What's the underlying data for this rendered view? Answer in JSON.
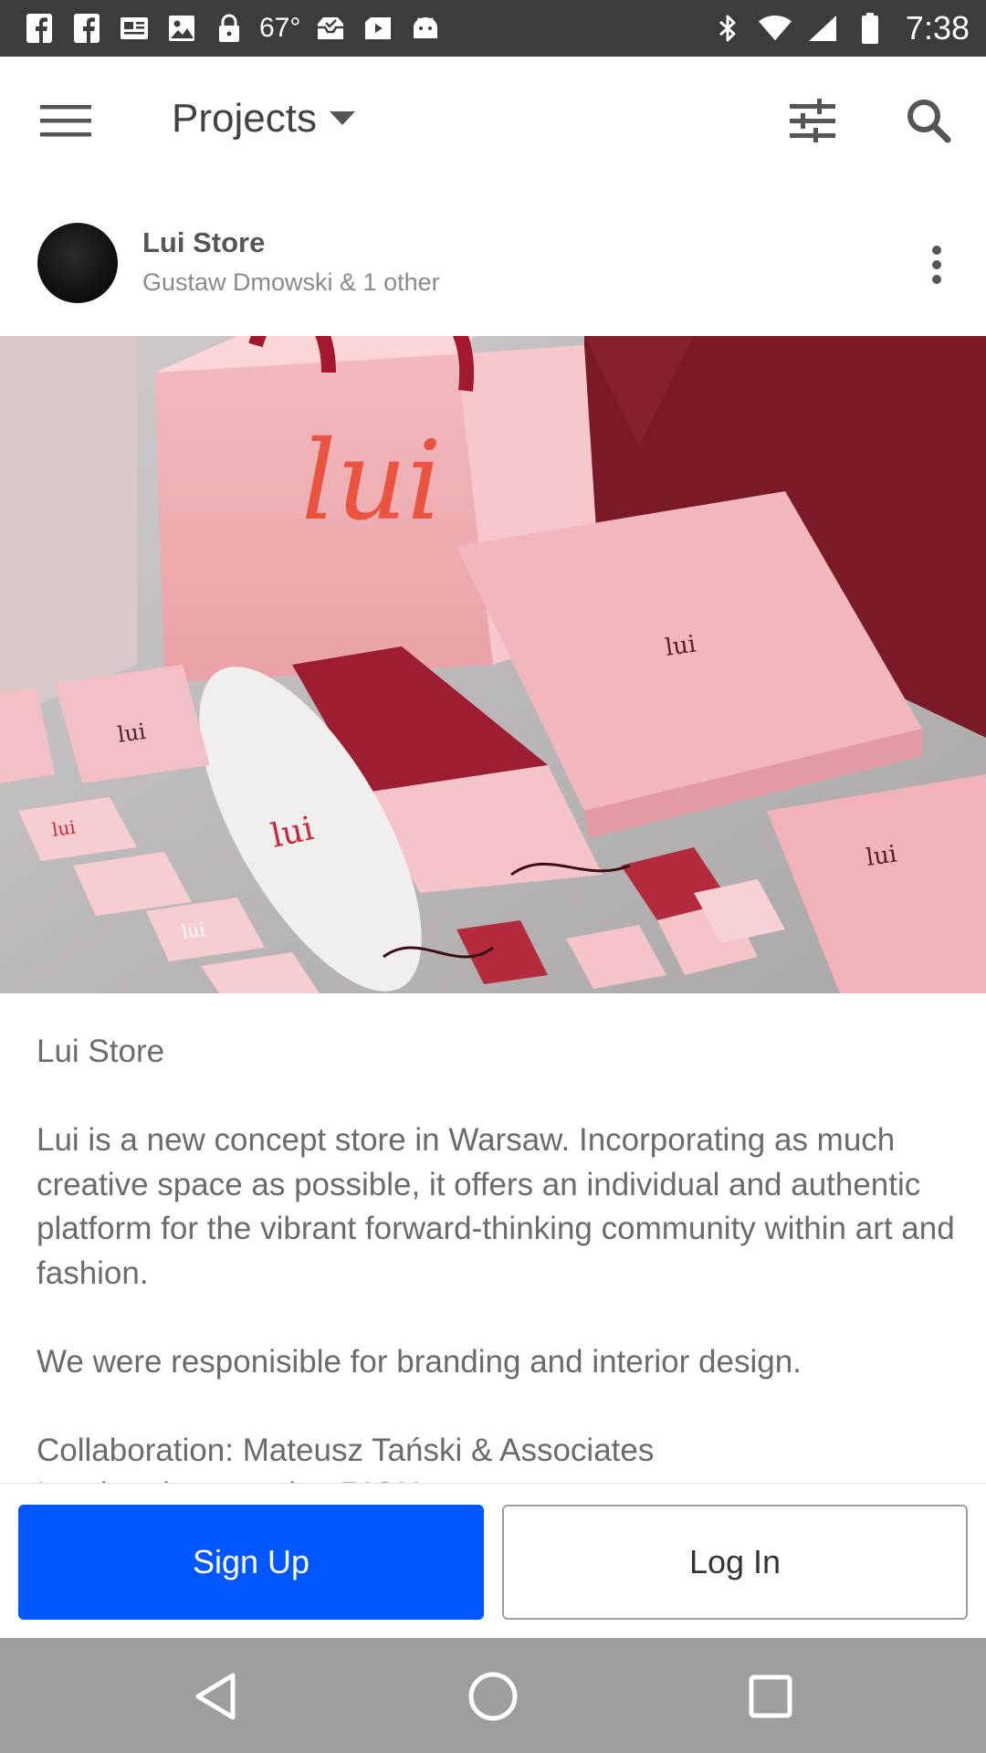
{
  "status_bar": {
    "battery_text": "67°",
    "time": "7:38",
    "icons": [
      "facebook-icon",
      "facebook-icon",
      "news-icon",
      "image-icon",
      "lock-icon",
      "thermometer-icon",
      "inbox-icon",
      "video-icon",
      "android-icon",
      "bluetooth-icon",
      "wifi-icon",
      "signal-icon",
      "battery-icon"
    ]
  },
  "app_bar": {
    "title": "Projects",
    "icons": [
      "menu-icon",
      "dropdown-arrow-icon",
      "tune-icon",
      "search-icon"
    ]
  },
  "project": {
    "title": "Lui Store",
    "owners": "Gustaw Dmowski & 1 other",
    "image_brand_mark": "lui"
  },
  "description": {
    "heading": "Lui Store",
    "paragraph_1": "Lui is a new concept store in Warsaw. Incorporating as much creative space as possible, it offers an individual and authentic platform for the vibrant forward-thinking community within art and fashion.",
    "paragraph_2": "We were responisible for branding and interior design.",
    "paragraph_3": "Collaboration: Mateusz Tański & Associates",
    "paragraph_4": "Interior photography: RIGN"
  },
  "actions": {
    "signup_label": "Sign Up",
    "login_label": "Log In"
  },
  "colors": {
    "primary": "#0057ff",
    "status_bar": "#3c3c3c",
    "nav_bar": "#9e9e9e"
  }
}
